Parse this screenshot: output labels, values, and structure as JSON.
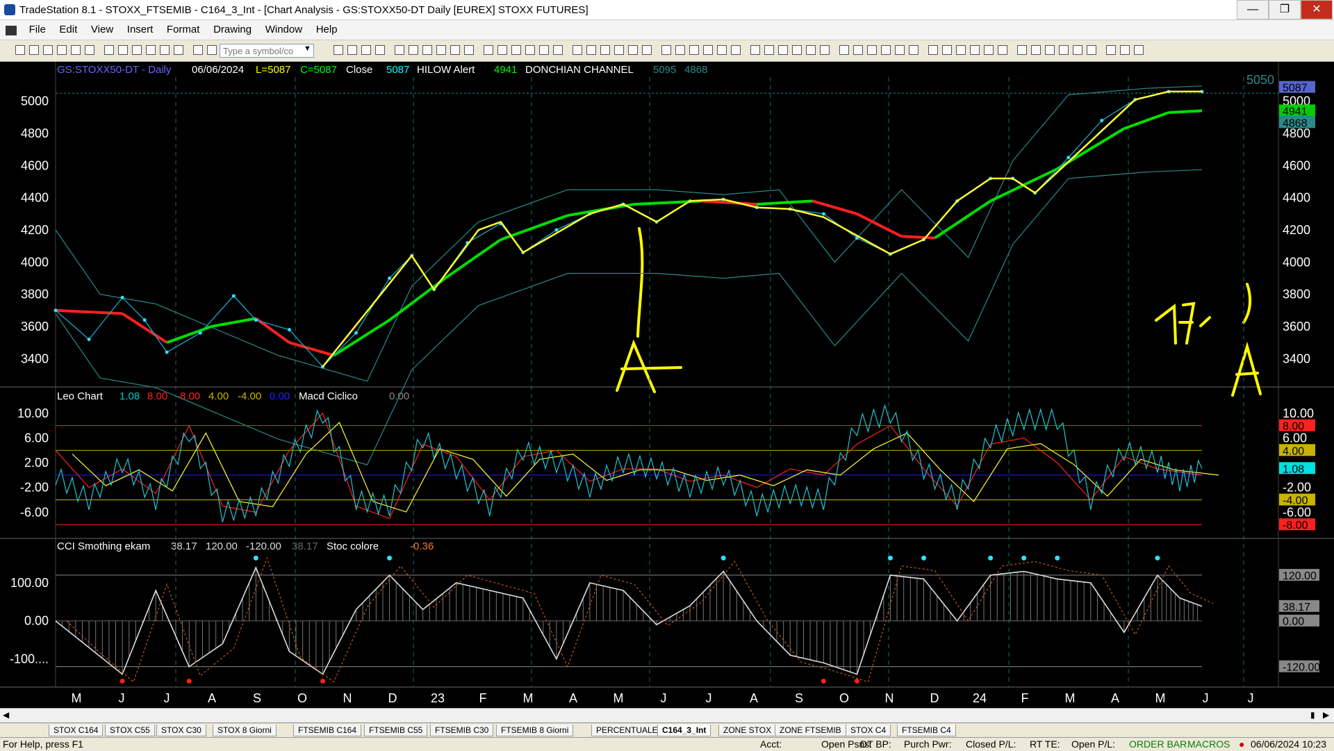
{
  "window": {
    "title": "TradeStation 8.1 - STOXX_FTSEMIB - C164_3_Int - [Chart Analysis - GS:STOXX50-DT  Daily  [EUREX] STOXX FUTURES]"
  },
  "menu": [
    "File",
    "Edit",
    "View",
    "Insert",
    "Format",
    "Drawing",
    "Window",
    "Help"
  ],
  "toolbar": {
    "symbol_placeholder": "Type a symbol/co"
  },
  "price_panel": {
    "symbol": "GS:STOXX50-DT - Daily",
    "date": "06/06/2024",
    "low_text": "L=5087",
    "close_text": "C=5087",
    "close_label": "Close",
    "close_value": "5087",
    "hilow_label": "HILOW Alert",
    "hilow_value": "4941",
    "donchian_label": "DONCHIAN CHANNEL",
    "donchian_upper": "5095",
    "donchian_lower": "4868",
    "level_label": "5050",
    "axis_ticks": [
      "5000",
      "4800",
      "4600",
      "4400",
      "4200",
      "4000",
      "3800",
      "3600",
      "3400"
    ],
    "right_tags": [
      {
        "text": "5087",
        "color": "#5566cc",
        "value": 5087
      },
      {
        "text": "4941",
        "color": "#00cc00",
        "value": 4941
      },
      {
        "text": "4868",
        "color": "#2a8a8a",
        "value": 4868
      }
    ],
    "annotations": [
      "A",
      "A",
      "1/7",
      ")"
    ]
  },
  "macd_panel": {
    "label": "Leo Chart",
    "values": [
      "1.08",
      "8.00",
      "-8.00",
      "4.00",
      "-4.00",
      "0.00"
    ],
    "value_colors": [
      "#00cccc",
      "#ff2020",
      "#ff2020",
      "#c8b400",
      "#c8b400",
      "#2020ff"
    ],
    "macd_label": "Macd Ciclico",
    "macd_value": "0.00",
    "axis_ticks": [
      "10.00",
      "6.00",
      "2.00",
      "-2.00",
      "-6.00"
    ],
    "right_tags": [
      {
        "text": "8.00",
        "bg": "#ff2020",
        "color": "#000",
        "value": 8
      },
      {
        "text": "4.00",
        "bg": "#c8b400",
        "color": "#000",
        "value": 4
      },
      {
        "text": "1.08",
        "bg": "#00e0e0",
        "color": "#000",
        "value": 1.08
      },
      {
        "text": "-4.00",
        "bg": "#c8b400",
        "color": "#000",
        "value": -4
      },
      {
        "text": "-8.00",
        "bg": "#ff2020",
        "color": "#000",
        "value": -8
      }
    ]
  },
  "cci_panel": {
    "label": "CCI Smothing ekam",
    "values": [
      "38.17",
      "120.00",
      "-120.00",
      "38.17"
    ],
    "stoc_label": "Stoc colore",
    "stoc_value": "-0.36",
    "axis_ticks": [
      "100.00",
      "0.00",
      "-100...."
    ],
    "right_tags": [
      {
        "text": "120.00",
        "value": 120
      },
      {
        "text": "38.17",
        "value": 38.17
      },
      {
        "text": "0.00",
        "value": 0
      },
      {
        "text": "-120.00",
        "value": -120
      }
    ]
  },
  "time_axis": [
    "M",
    "J",
    "J",
    "A",
    "S",
    "O",
    "N",
    "D",
    "23",
    "F",
    "M",
    "A",
    "M",
    "J",
    "J",
    "A",
    "S",
    "O",
    "N",
    "D",
    "24",
    "F",
    "M",
    "A",
    "M",
    "J",
    "J"
  ],
  "chart_data": {
    "type": "line",
    "x_range": [
      "2022-05",
      "2024-07"
    ],
    "price": {
      "ylim": [
        3250,
        5150
      ],
      "series": [
        {
          "name": "Close",
          "points": [
            [
              0,
              3700
            ],
            [
              3,
              3520
            ],
            [
              6,
              3780
            ],
            [
              8,
              3640
            ],
            [
              10,
              3440
            ],
            [
              13,
              3560
            ],
            [
              16,
              3790
            ],
            [
              18,
              3640
            ],
            [
              21,
              3580
            ],
            [
              24,
              3350
            ],
            [
              27,
              3560
            ],
            [
              30,
              3900
            ],
            [
              32,
              4040
            ],
            [
              34,
              3830
            ],
            [
              37,
              4120
            ],
            [
              40,
              4240
            ],
            [
              42,
              4060
            ],
            [
              45,
              4200
            ],
            [
              48,
              4300
            ],
            [
              51,
              4360
            ],
            [
              54,
              4250
            ],
            [
              57,
              4380
            ],
            [
              60,
              4390
            ],
            [
              63,
              4340
            ],
            [
              66,
              4330
            ],
            [
              69,
              4300
            ],
            [
              72,
              4150
            ],
            [
              75,
              4050
            ],
            [
              78,
              4140
            ],
            [
              81,
              4380
            ],
            [
              84,
              4520
            ],
            [
              86,
              4520
            ],
            [
              88,
              4430
            ],
            [
              91,
              4650
            ],
            [
              94,
              4880
            ],
            [
              97,
              5010
            ],
            [
              100,
              5060
            ],
            [
              103,
              5060
            ]
          ]
        },
        {
          "name": "HILOW Alert",
          "points": [
            [
              0,
              3700
            ],
            [
              6,
              3680
            ],
            [
              10,
              3500
            ],
            [
              14,
              3600
            ],
            [
              18,
              3650
            ],
            [
              21,
              3500
            ],
            [
              25,
              3420
            ],
            [
              30,
              3640
            ],
            [
              35,
              3900
            ],
            [
              40,
              4140
            ],
            [
              46,
              4290
            ],
            [
              52,
              4360
            ],
            [
              58,
              4380
            ],
            [
              63,
              4360
            ],
            [
              68,
              4380
            ],
            [
              72,
              4300
            ],
            [
              76,
              4160
            ],
            [
              79,
              4150
            ],
            [
              84,
              4380
            ],
            [
              90,
              4580
            ],
            [
              96,
              4830
            ],
            [
              100,
              4930
            ],
            [
              103,
              4941
            ]
          ]
        },
        {
          "name": "DONCHIAN CHANNEL",
          "points": [
            [
              0,
              4200
            ],
            [
              4,
              3800
            ],
            [
              9,
              3740
            ],
            [
              20,
              3420
            ],
            [
              28,
              3260
            ],
            [
              32,
              3850
            ],
            [
              38,
              4250
            ],
            [
              46,
              4450
            ],
            [
              54,
              4450
            ],
            [
              60,
              4420
            ],
            [
              65,
              4450
            ],
            [
              70,
              4000
            ],
            [
              76,
              4450
            ],
            [
              82,
              4030
            ],
            [
              86,
              4630
            ],
            [
              91,
              5040
            ],
            [
              98,
              5080
            ],
            [
              103,
              5095
            ]
          ]
        }
      ]
    },
    "macd": {
      "ylim": [
        -10,
        12
      ],
      "series": [
        {
          "name": "Leo Chart",
          "points": [
            [
              0,
              0
            ],
            [
              3,
              -4
            ],
            [
              6,
              2
            ],
            [
              9,
              -4
            ],
            [
              12,
              7
            ],
            [
              15,
              -6
            ],
            [
              18,
              -5
            ],
            [
              21,
              3
            ],
            [
              24,
              10
            ],
            [
              27,
              -4
            ],
            [
              30,
              -5
            ],
            [
              33,
              6
            ],
            [
              36,
              1
            ],
            [
              39,
              -5
            ],
            [
              42,
              4
            ],
            [
              45,
              2
            ],
            [
              48,
              -2
            ],
            [
              51,
              2
            ],
            [
              54,
              1
            ],
            [
              57,
              -2
            ],
            [
              60,
              0
            ],
            [
              63,
              -5
            ],
            [
              66,
              -3
            ],
            [
              69,
              -4
            ],
            [
              72,
              8
            ],
            [
              75,
              10
            ],
            [
              78,
              1
            ],
            [
              81,
              -4
            ],
            [
              84,
              6
            ],
            [
              87,
              9
            ],
            [
              90,
              9
            ],
            [
              93,
              -4
            ],
            [
              96,
              4
            ],
            [
              99,
              2
            ],
            [
              101,
              -1
            ],
            [
              103,
              1.08
            ]
          ]
        },
        {
          "name": "Macd Ciclico",
          "points": [
            [
              0,
              4
            ],
            [
              3,
              -2
            ],
            [
              6,
              1
            ],
            [
              9,
              -3
            ],
            [
              12,
              8
            ],
            [
              15,
              -5
            ],
            [
              18,
              -6
            ],
            [
              21,
              4
            ],
            [
              24,
              10
            ],
            [
              27,
              -5
            ],
            [
              30,
              -7
            ],
            [
              33,
              5
            ],
            [
              36,
              3
            ],
            [
              39,
              -4
            ],
            [
              42,
              3
            ],
            [
              45,
              4
            ],
            [
              48,
              -1
            ],
            [
              51,
              1
            ],
            [
              54,
              1
            ],
            [
              57,
              -1
            ],
            [
              60,
              0
            ],
            [
              63,
              -2
            ],
            [
              66,
              1
            ],
            [
              69,
              0
            ],
            [
              72,
              5
            ],
            [
              75,
              8
            ],
            [
              78,
              1
            ],
            [
              81,
              -5
            ],
            [
              84,
              5
            ],
            [
              87,
              6
            ],
            [
              90,
              2
            ],
            [
              93,
              -4
            ],
            [
              96,
              3
            ],
            [
              99,
              1
            ],
            [
              103,
              0
            ]
          ]
        }
      ]
    },
    "cci": {
      "ylim": [
        -170,
        180
      ],
      "series": [
        {
          "name": "CCI Smothing ekam",
          "points": [
            [
              0,
              0
            ],
            [
              3,
              -70
            ],
            [
              6,
              -140
            ],
            [
              9,
              80
            ],
            [
              12,
              -120
            ],
            [
              15,
              -60
            ],
            [
              18,
              140
            ],
            [
              21,
              -80
            ],
            [
              24,
              -140
            ],
            [
              27,
              30
            ],
            [
              30,
              120
            ],
            [
              33,
              30
            ],
            [
              36,
              100
            ],
            [
              39,
              80
            ],
            [
              42,
              60
            ],
            [
              45,
              -100
            ],
            [
              48,
              100
            ],
            [
              51,
              80
            ],
            [
              54,
              -10
            ],
            [
              57,
              40
            ],
            [
              60,
              130
            ],
            [
              63,
              0
            ],
            [
              66,
              -90
            ],
            [
              69,
              -110
            ],
            [
              72,
              -140
            ],
            [
              75,
              120
            ],
            [
              78,
              110
            ],
            [
              81,
              0
            ],
            [
              84,
              120
            ],
            [
              87,
              130
            ],
            [
              90,
              110
            ],
            [
              93,
              100
            ],
            [
              96,
              -30
            ],
            [
              99,
              120
            ],
            [
              101,
              60
            ],
            [
              103,
              38.17
            ]
          ]
        }
      ]
    }
  }
}
